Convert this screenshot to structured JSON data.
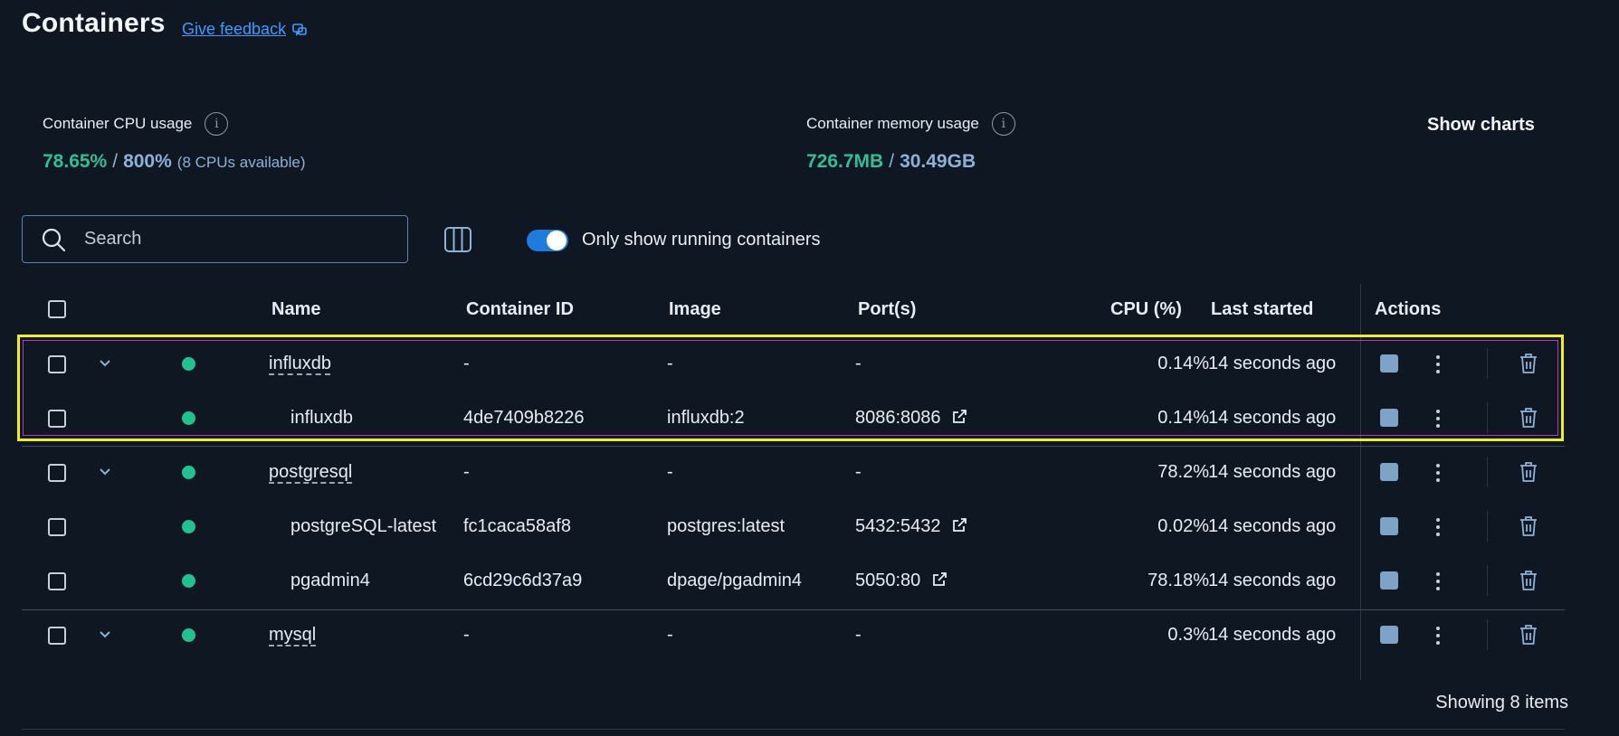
{
  "header": {
    "title": "Containers",
    "feedback_label": "Give feedback"
  },
  "stats": {
    "cpu": {
      "label": "Container CPU usage",
      "used": "78.65%",
      "sep": "/",
      "total": "800%",
      "note": "(8 CPUs available)"
    },
    "memory": {
      "label": "Container memory usage",
      "used": "726.7MB",
      "sep": "/",
      "total": "30.49GB"
    },
    "show_charts_label": "Show charts",
    "info_glyph": "i"
  },
  "toolbar": {
    "search_placeholder": "Search",
    "running_only_label": "Only show running containers",
    "running_only_enabled": true
  },
  "table": {
    "columns": {
      "name": "Name",
      "container_id": "Container ID",
      "image": "Image",
      "ports": "Port(s)",
      "cpu": "CPU (%)",
      "last_started": "Last started",
      "actions": "Actions"
    },
    "rows": [
      {
        "type": "group",
        "name": "influxdb",
        "container_id": "-",
        "image": "-",
        "ports": "-",
        "cpu": "0.14%",
        "last_started": "14 seconds ago",
        "status": "running"
      },
      {
        "type": "child",
        "name": "influxdb",
        "container_id": "4de7409b8226",
        "image": "influxdb:2",
        "ports": "8086:8086",
        "cpu": "0.14%",
        "last_started": "14 seconds ago",
        "status": "running"
      },
      {
        "type": "group",
        "name": "postgresql",
        "container_id": "-",
        "image": "-",
        "ports": "-",
        "cpu": "78.2%",
        "last_started": "14 seconds ago",
        "status": "running"
      },
      {
        "type": "child",
        "name": "postgreSQL-latest",
        "container_id": "fc1caca58af8",
        "image": "postgres:latest",
        "ports": "5432:5432",
        "cpu": "0.02%",
        "last_started": "14 seconds ago",
        "status": "running"
      },
      {
        "type": "child",
        "name": "pgadmin4",
        "container_id": "6cd29c6d37a9",
        "image": "dpage/pgadmin4",
        "ports": "5050:80",
        "cpu": "78.18%",
        "last_started": "14 seconds ago",
        "status": "running"
      },
      {
        "type": "group",
        "name": "mysql",
        "container_id": "-",
        "image": "-",
        "ports": "-",
        "cpu": "0.3%",
        "last_started": "14 seconds ago",
        "status": "running"
      }
    ]
  },
  "footer": {
    "items_label": "Showing 8 items"
  },
  "colors": {
    "background": "#0f1722",
    "accent": "#1f7bdc",
    "running": "#21c292",
    "highlight": "#f2ee1e"
  },
  "icons": {
    "search": "search-icon",
    "columns": "columns-icon",
    "chevron": "chevron-down-icon",
    "external_link": "external-link-icon",
    "stop": "stop-icon",
    "more": "more-vertical-icon",
    "trash": "trash-icon",
    "info": "info-icon",
    "feedback": "feedback-icon"
  }
}
